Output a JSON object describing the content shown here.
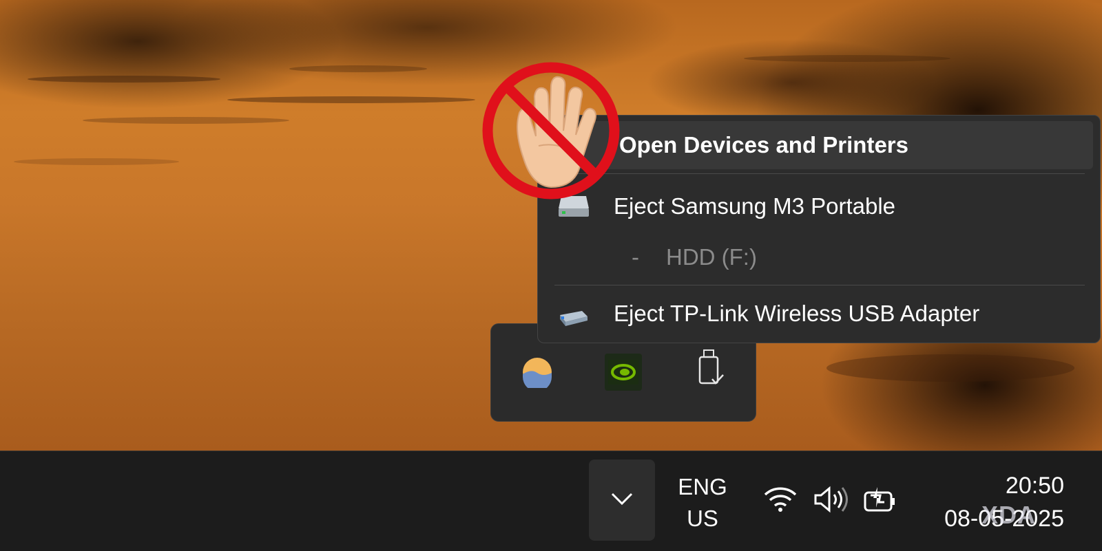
{
  "context_menu": {
    "items": [
      {
        "label": "Open Devices and Printers",
        "icon": "none"
      },
      {
        "label": "Eject Samsung M3 Portable",
        "icon": "drive-icon"
      },
      {
        "label": "HDD (F:)",
        "prefix": "-",
        "icon": "none"
      },
      {
        "label": "Eject TP-Link Wireless USB Adapter",
        "icon": "usb-adapter-icon"
      }
    ]
  },
  "tray_flyout": {
    "icons": [
      "weather-sun-icon",
      "nvidia-icon",
      "safely-remove-usb-icon"
    ]
  },
  "taskbar": {
    "language": {
      "line1": "ENG",
      "line2": "US"
    },
    "system_icons": [
      "wifi-icon",
      "volume-icon",
      "battery-charging-icon"
    ],
    "clock": {
      "time": "20:50",
      "date": "08-05-2025"
    }
  },
  "watermark": {
    "text": "XDA"
  },
  "colors": {
    "menu_bg": "#2c2c2c",
    "taskbar_bg": "#1c1c1c",
    "prohibit_red": "#e0101b",
    "nvidia_green": "#76b900"
  }
}
